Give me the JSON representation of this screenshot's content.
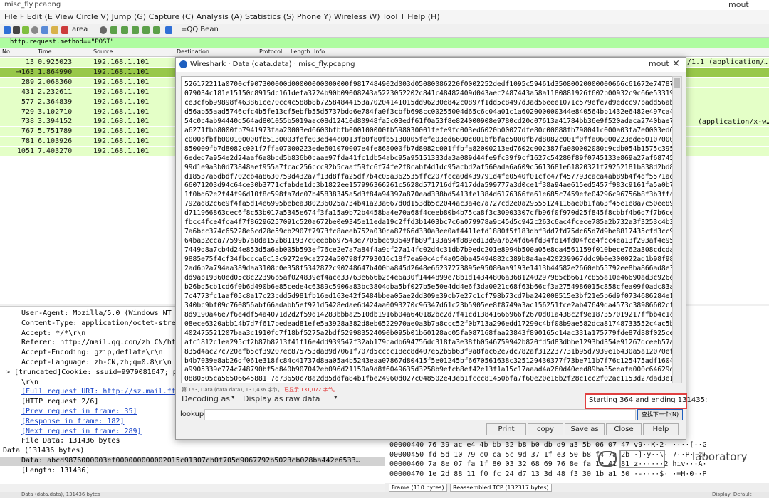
{
  "window": {
    "title": "misc_fly.pcapng",
    "right_label": "mout"
  },
  "menu": {
    "text": "File F Edit (E View Circle V) Jump (G) Capture (C) Analysis (A) Statistics (S) Phone Y) Wireless W) Tool T Help (H)"
  },
  "toolbar": {
    "area_label": "area",
    "bean_label": "=QQ Bean"
  },
  "filter": {
    "text": "http.request.method==\"POST\""
  },
  "packet_list": {
    "headers": {
      "no": "No.",
      "time": "Time",
      "source": "Source",
      "destination": "Destination",
      "protocol": "Protocol",
      "length": "Length",
      "info": "Info"
    },
    "rows": [
      {
        "no": "13",
        "time": "0.925023",
        "source": "192.168.1.101",
        "selected": false
      },
      {
        "no": "163",
        "time": "1.864990",
        "source": "192.168.1.101",
        "selected": true
      },
      {
        "no": "289",
        "time": "2.068360",
        "source": "192.168.1.101",
        "selected": false
      },
      {
        "no": "431",
        "time": "2.232611",
        "source": "192.168.1.101",
        "selected": false
      },
      {
        "no": "577",
        "time": "2.364839",
        "source": "192.168.1.101",
        "selected": false
      },
      {
        "no": "729",
        "time": "3.102710",
        "source": "192.168.1.101",
        "selected": false
      },
      {
        "no": "738",
        "time": "3.394152",
        "source": "192.168.1.101",
        "selected": false
      },
      {
        "no": "767",
        "time": "5.751789",
        "source": "192.168.1.101",
        "selected": false
      },
      {
        "no": "781",
        "time": "6.103926",
        "source": "192.168.1.101",
        "selected": false
      },
      {
        "no": "1051",
        "time": "7.403270",
        "source": "192.168.1.101",
        "selected": false
      }
    ],
    "info_row1": "/1.1  (application/…",
    "info_row2": "(application/x-w…"
  },
  "details": {
    "lines": [
      "User-Agent: Mozilla/5.0 (Windows NT 6.1",
      "Content-Type: application/octet-stream\\",
      "Accept: */*\\r\\n",
      "Referer: http://mail.qq.com/zh_CN/htmle",
      "Accept-Encoding: gzip,deflate\\r\\n",
      "Accept-Language: zh-CN,zh;q=0.8\\r\\n",
      "[truncated]Cookie: ssuid=9979081647; p",
      "\\r\\n",
      "[Full request URI: http://sz.mail.ftn.q",
      "[HTTP request 2/6]",
      "[Prev request in frame: 35]",
      "[Response in frame: 182]",
      "[Next request in frame: 289]",
      "File Data: 131436 bytes",
      "Data (131436 bytes)",
      "Data: abcd9876000003ef000000000002015c01307cb0f705d9067792b5023cb028ba442e6533…",
      "[Length: 131436]"
    ]
  },
  "bytes": {
    "lines": [
      "00000440  76 39 ac e4 4b bb 32 b8  b0 db d9 a3 5b 06 07 47   v9··K·2·  ····[··G",
      "00000450  fd 5d 10 79 c0 ca 5c 9d  37 1f e3 50 b8 f4 7a 2b   ·]·y··\\·  7··P··z+",
      "00000460  7a 8e 07 fa 1f 80 03 32  68 69 76 8e fa 1e 41 81   z······2  hiv···A·",
      "00000470  1e 2d 88 11 f0 fc 24 d7  13 3d 48 f3 30 1b a1 50   ·-····$·  ·=H·0··P"
    ],
    "frame_tab": "Frame (110 bytes)",
    "tcp_tab": "Reassembled TCP (132317 bytes)"
  },
  "status": {
    "left": "Data (data.data), 131436 bytes",
    "right": "Display: Default"
  },
  "dialog": {
    "title": "Wireshark · Data (data.data) · misc_fly.pcapng",
    "mout": "mout",
    "close": "×",
    "hex_lines": [
      "526172211a0700cf907300000d00000000000000f9817484902d003d05080086220f0002252dedf1095c59461d35080020000000666c61672e74787400f",
      "079034c181e15150c8915dc161defa3724b90b09008243a5223052202c841c48482409d043aec2487443a58a1180881926f602b00932c9c66e5331999c5",
      "ce3cf6b99898f463861ce70cc4c588b8b72584844153a70204141015dd96230e842c0897f1dd5c8497d3ad56eee1071c579efe7d9edcc97badd56ab55aa",
      "d56ab55aad5746cfc4b5fe13cf5ebfb55d5737bdd6e784fa0f3cbfb698cc00255004d65c6c04a01c1a602000000344e840564bb1432e6482e497ca4645",
      "54c0c4ab94440d564ad801055b5019aac08d12410d80948fa5c03edf61f0a53f8e824000908e9780cd20c07613a41784bb36e9f520adaca2740bae70b648",
      "a6271fbb8000fb7941973faa20003ed6600bfbfb000100000fb598030001fefe9fc003ed6020b00027dfe80c00088fb798041c000a03fa7e0003ed6602",
      "c000bfbfb000100000fb5130003fefe03ed44c0013fb0f80fb5130005fefe03ed6600c001bfbfac5000fb7d8082c001f0ffa06000223ede601070007c9fe",
      "850000fb7d8082c001f7ffa07000223ede601070007e4fe868000fb7d8082c001ffbfa82000213ed7602c002387fa080002080c9cdb054b1575c39542aa",
      "6eded7a954e2d24aaf6a8bcd5b836b0caae97fda41fc1db54abc95a95151333da3a089d44fe9fc39f9cf1627c54280f89f0745133e869a27af687453f13",
      "99d1e9a3b0d73848aef955a7fcac256ccc92b5caaf59fc6f74fe2f8cabf4d1dc95acbd2af560ada6a609c5613681e61820321f79252181b838d2bd8f2ab",
      "d18537a6dbdf702cb4a8630759d432a7f13d8ffa25df7b4c05a362535ffc207fcca0d439791d4fe0540f01cfc47f457793caca4ab89b4f4df5571ad677",
      "66071203d94c64ce30b3771cfabde1dc3b1822ee157996366261c5628d571716df2417dda599777a3d0ce1f38a94ae615ed5457f983c9161fa5a0b7356c",
      "1f0bd62e2f44f96d10f8c598fa7dc07b45838345a5d3f84a94397a870ead338bd5413fe1384d6176366fa61e685c7459efe04296c96756b8f3b3ffc4e86",
      "792ad82c6e9f4fa5d14e6995bebea380236025a734b41a23a667d0d153db5c2044ac3a4e7a727cd2e0a29555124116ae0b1fa63f45e1e8a7c50ee89bf5c",
      "d711966863cec6f8c53b017a5345e674f3fa15a9b72b4458ba4e70a68f4ceeb80b4b75ca8f3c30903307cfb96f0f970d25f845f8cbbf4b6d7f7b6cea03",
      "fbcc4fce4fca4f7f86296257091c520a672be0e9345e11eda19c2ffd3b1403bc7c6a079978a9c45d5c942c263c6ac4fcece785a2b732a3f3253c4b3e0d",
      "7a6bcc374c65228e6cd28e59cb2907f7973fc8aeeb752a030ca87f66d330a3ee0af4411efd1880f5f183dbf3dd7fd75dc65d7d9be8817435cfd3cc94d9e",
      "64ba32cca77599b7a8da152b811937c0eebb697543e7705bed93649fb89f193a94f889ed13d9a7b24fd64fd34fd14fd04fce4fcc4ea13f293af4e953d7a",
      "7449d8a7cb4d24e853d5a6ab005b593ef76ce2e7a7a84f4a9cf27a14fc02d4c31db7b9edc201e8994b500a05e8ca4561159f010bece762a308cdcda671",
      "9885e75f4cf34fbccca6c13c9272e9ca2724a50798f7793016c18f7ea90c4cf4a050ba45494882c389b8a4ae420239967ddc9b0e300022ad1b98f98ede9",
      "2ad6b2a794aa389daa3108c0e358f5342872c90248647b400ba845d2648e66237273895e95080aa9193e1413b44582e2660eb55792ee8ba866ad8e37af2",
      "dd9ab19360ed05c8c22396b5af024839ef4ace33763e666b2c4e6a30f1444899e78b1d14344806a3681240297985cb6617c855a10e46690ad3c926ec672",
      "b26bd5cb1cd6f0b6d490b6e85cede4c6389c5906a83bc3804dba5bf027b5e50e4dd4e6f3da0021c68f63b66cf3a2754986015c858cfea09f0adc83aaa4b",
      "7c4773fc1aaf05c8a17c23cdd5d981fb16ed163e42f5484bbea05ae2dd309e39cb7e27c1cf798b73cd7ba242008515e3bf21e5b6d9f0734686284e1d8a",
      "340bc9bf09c760856abf66adabb5ef921d5428edae6d424aa0093270c96347d61c23b5905ee8f8749a3ac156251fce2ab47649da4573c38986602cff245",
      "8d9190a46e7f6e4df54a4071d2d2f59d14283bbba2510db1916b04a640182bc2d7f41cd13841666966f2670d01a438c2f9e187357019217ffbb4c1c5b28",
      "08ece6320abb14b7d7f617bedead81efe5a3928a382d8eb6522970ae0a3b7a8ccc52f0b713a296edd17290c4bf08b9ae582dca81748733552c4ac5b26be",
      "402475521207baa3c1910fd7f18bf5275a2bdf529983524090b095b01b60128ac05fa087168faa23843f890165c14ac331a175779fde87d88f025ce4020",
      "afc1812c1ea295cf2b87b8213f41f16e4dd939547f32ab179cadb694756dc318fa3e38fb0546759942b820fd5d83dbbe1293bd354e91267dceeb57adeac",
      "835d4ac27c720efb5cf39207ec875753da89d7061f707d5cccc18ec8d407e52b5b63f9a8fac62e7dc782af312237731b95d7939e16430a5a12070ef1d6a",
      "b4b7039e8ab26df061e318fc84c41737d8aa05a4b5243eaa07867d80415f5e01245bf6670561638c325129430377f73be711b7f76c125475adf160437d0",
      "a9905339e774c748790bf5d840b907042eb096d21150a9d8f6049635d3258b9efcb8ef42e13f1a15c17aaad4a260d40eed89ba35eeafa000c64629d37d4",
      "0880505ca56506645881 7d73650c78a2d85ddfa84b1fbe24960d027c048502e43eb1fccc81450bfa7f60e20e16b2f28c1cc2f02ac1153d27dad3e17b678",
      "0c70492fa70b487e428a1921fd0635c41b23311607b06cada545b8b4959701361cbd50b493a09fdfe91535972788ba43eb43122723bd205577696dec80"
    ],
    "info_prefix": "第 163, Data (data.data), 131,436 字节。",
    "info_red": "已显示 131,072 字节。",
    "decode_label": "Decoding as",
    "show_label": "Display as raw data",
    "range_text": "Starting 364 and ending 131435:",
    "find_label": "lookup",
    "find_button": "查找下一个(N)",
    "buttons": {
      "print": "Print",
      "copy": "copy",
      "save_as": "Save as",
      "close": "Close",
      "help": "Help"
    }
  },
  "watermark": {
    "text": "laboratory"
  }
}
